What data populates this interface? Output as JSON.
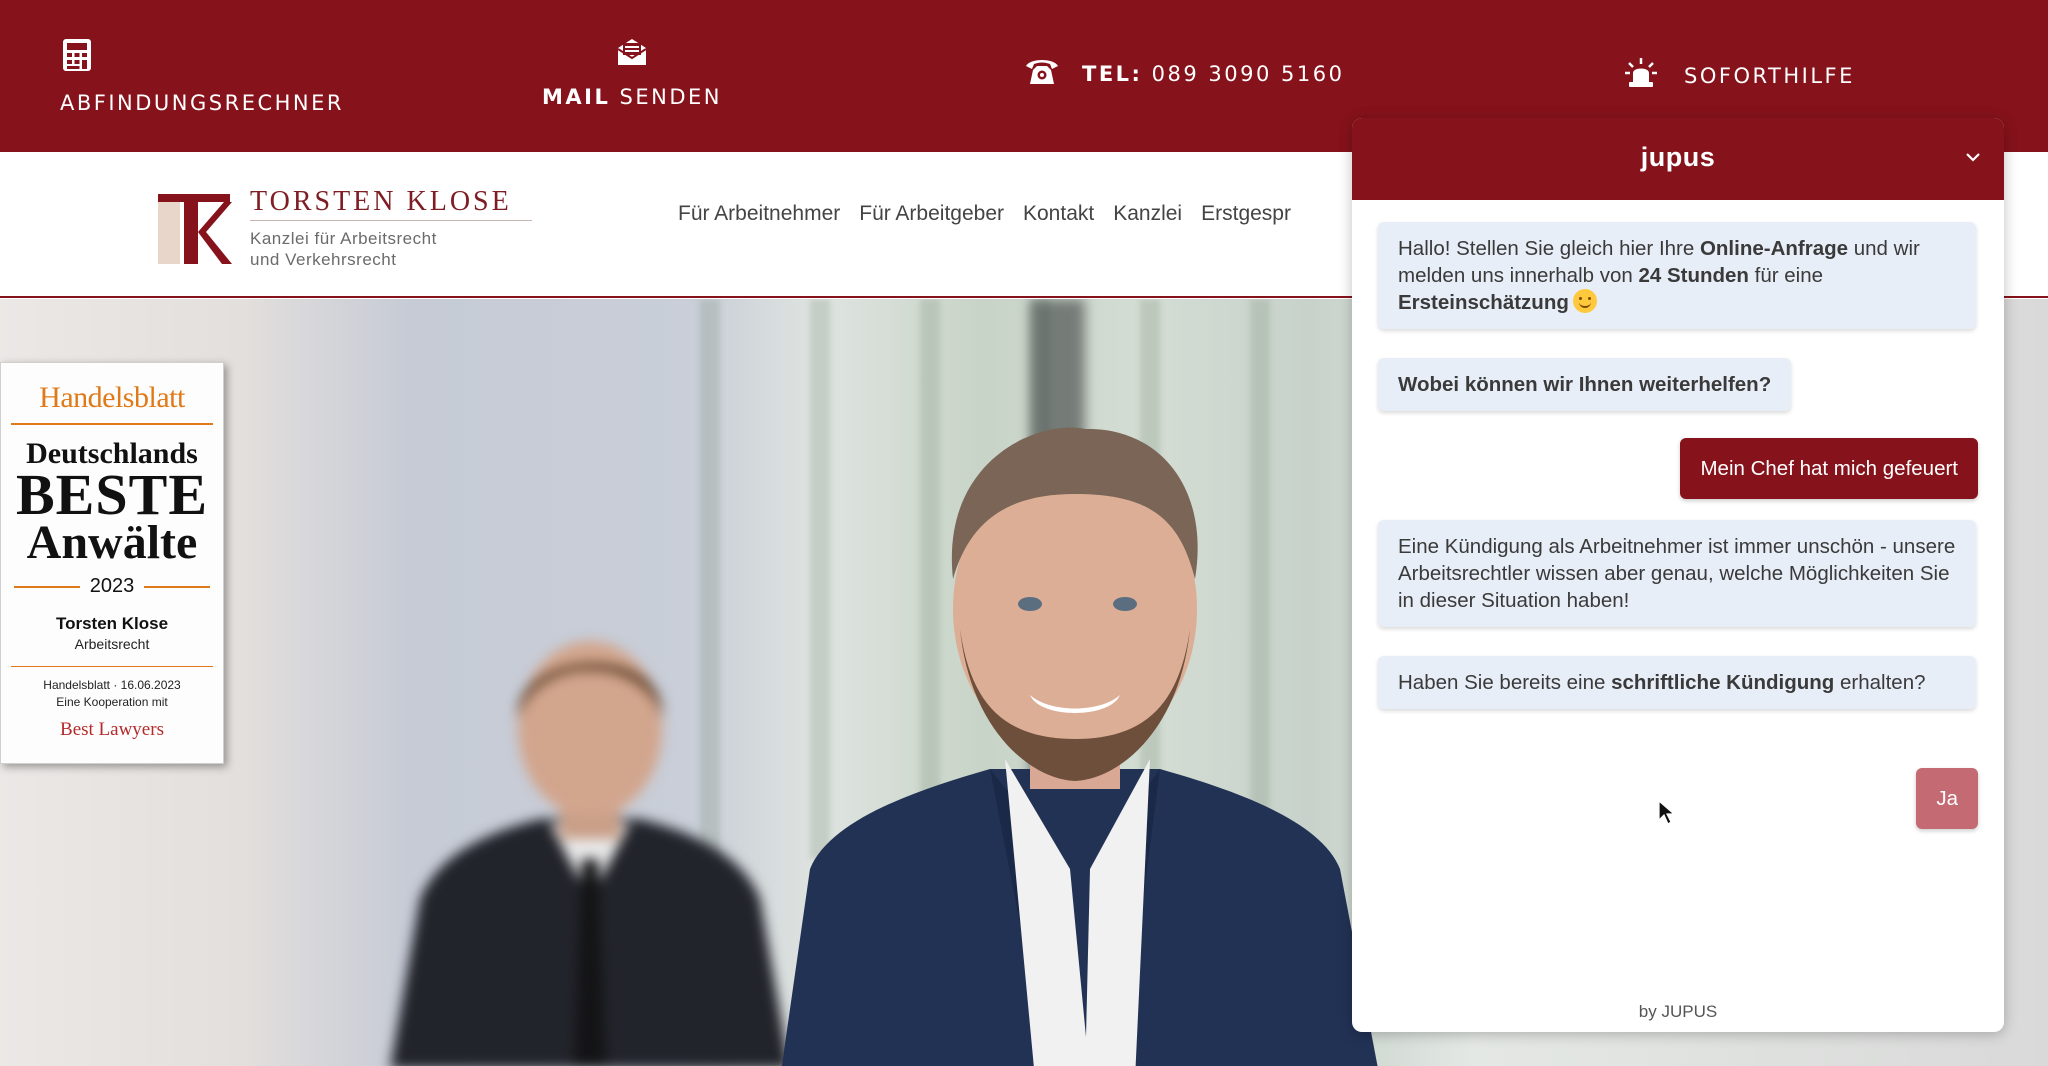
{
  "colors": {
    "brand": "#86121b",
    "award_orange": "#e07a18",
    "bot_bubble": "#e8eef7"
  },
  "topbar": {
    "calculator": {
      "icon": "calculator-icon",
      "label": "ABFINDUNGSRECHNER"
    },
    "mail": {
      "icon": "mail-icon",
      "label_bold": "MAIL",
      "label_rest": "SENDEN"
    },
    "phone": {
      "icon": "phone-icon",
      "label_bold": "TEL:",
      "number": "089 3090 5160"
    },
    "emergency": {
      "icon": "siren-icon",
      "label": "SOFORTHILFE"
    }
  },
  "header": {
    "logo": {
      "name": "TORSTEN KLOSE",
      "sub_line1": "Kanzlei für Arbeitsrecht",
      "sub_line2": "und Verkehrsrecht"
    },
    "nav": [
      "Für Arbeitnehmer",
      "Für Arbeitgeber",
      "Kontakt",
      "Kanzlei",
      "Erstgespr"
    ]
  },
  "award": {
    "publisher": "Handelsblatt",
    "line1": "Deutschlands",
    "line2": "BESTE",
    "line3": "Anwälte",
    "year": "2023",
    "name": "Torsten Klose",
    "area": "Arbeitsrecht",
    "meta1": "Handelsblatt · 16.06.2023",
    "meta2": "Eine Kooperation mit",
    "partner": "Best Lawyers"
  },
  "chat": {
    "title": "jupus",
    "messages": [
      {
        "from": "bot",
        "t1": "Hallo! Stellen Sie gleich hier Ihre ",
        "b1": "Online-Anfrage",
        "t2": " und wir melden uns innerhalb von ",
        "b2": "24 Stunden",
        "t3": " für eine ",
        "b3": "Ersteinschätzung"
      },
      {
        "from": "bot",
        "text": "Wobei können wir Ihnen weiterhelfen?"
      },
      {
        "from": "user",
        "text": "Mein Chef hat mich gefeuert"
      },
      {
        "from": "bot",
        "text": "Eine Kündigung als Arbeitnehmer ist immer unschön - unsere Arbeitsrechtler wissen aber genau, welche Möglichkeiten Sie in dieser Situation haben!"
      },
      {
        "from": "bot",
        "t1": "Haben Sie bereits eine ",
        "b1": "schriftliche Kündigung",
        "t2": " erhalten?"
      },
      {
        "from": "user",
        "text": "Ja"
      }
    ],
    "footer": "by JUPUS"
  }
}
